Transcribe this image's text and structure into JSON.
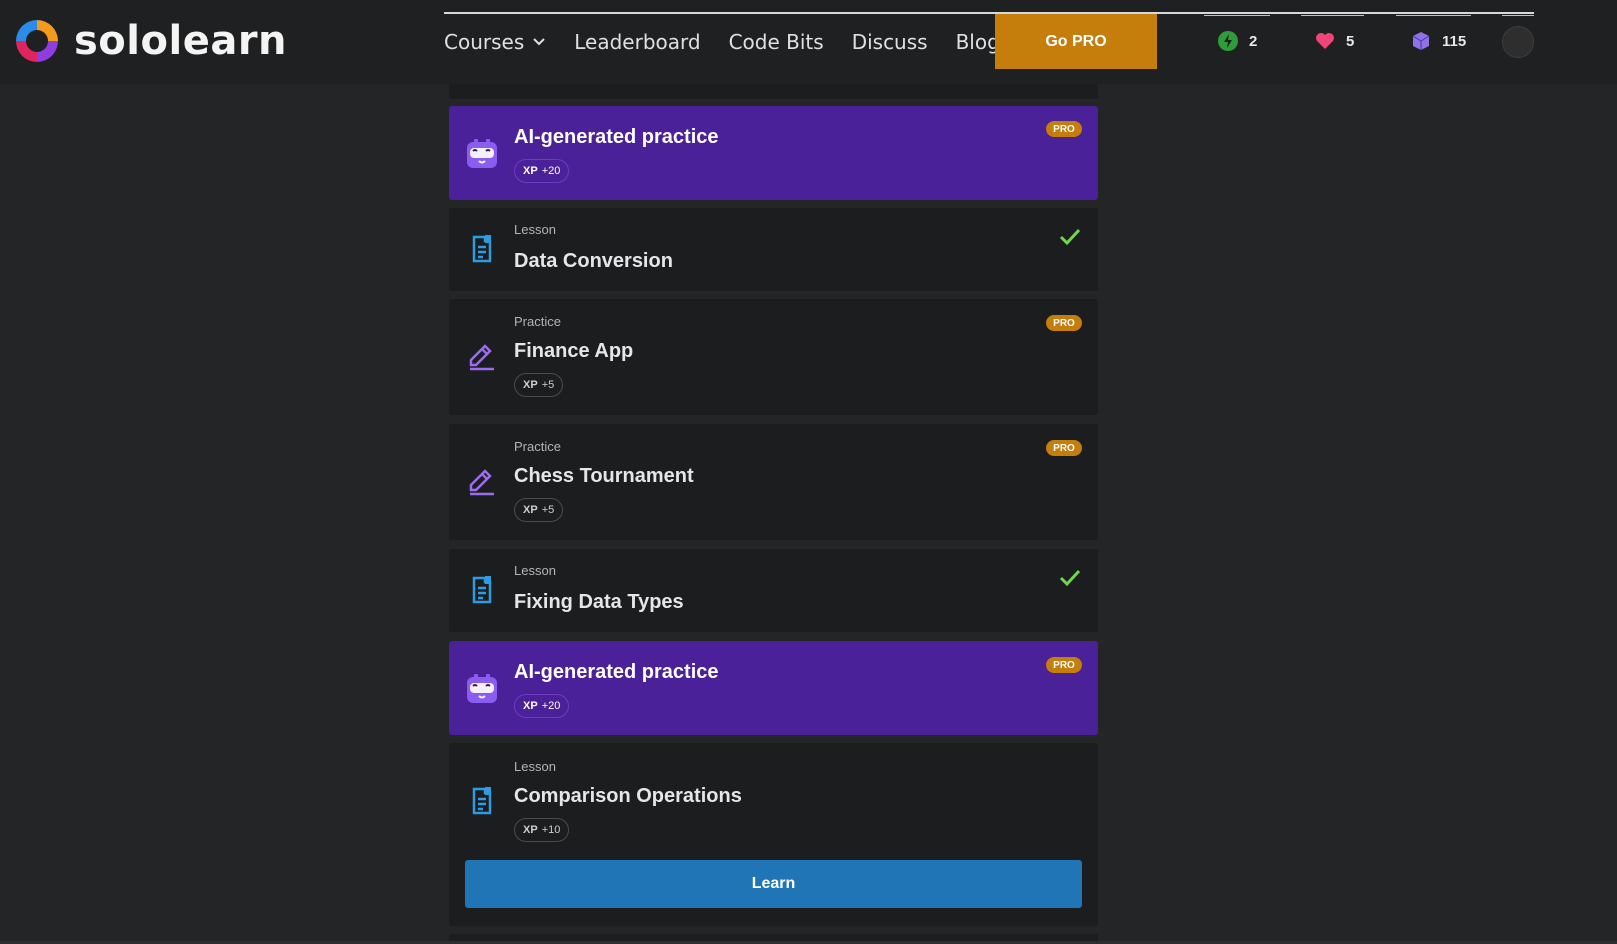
{
  "brand": {
    "name": "sololearn"
  },
  "nav": {
    "items": [
      {
        "label": "Courses"
      },
      {
        "label": "Leaderboard"
      },
      {
        "label": "Code Bits"
      },
      {
        "label": "Discuss"
      },
      {
        "label": "Blog"
      }
    ],
    "gopro_label": "Go PRO"
  },
  "stats": {
    "streak": "2",
    "hearts": "5",
    "bits": "115"
  },
  "colors": {
    "accent_purple": "#4a2199",
    "pro_orange": "#c57d0b",
    "learn_blue": "#1f75b5",
    "check_green": "#6cd84a"
  },
  "list": [
    {
      "type": "ai",
      "title": "AI-generated practice",
      "xp": "+20",
      "pro": "PRO"
    },
    {
      "type": "lesson",
      "kind": "Lesson",
      "title": "Data Conversion",
      "done": true
    },
    {
      "type": "practice",
      "kind": "Practice",
      "title": "Finance App",
      "xp": "+5",
      "pro": "PRO"
    },
    {
      "type": "practice",
      "kind": "Practice",
      "title": "Chess Tournament",
      "xp": "+5",
      "pro": "PRO"
    },
    {
      "type": "lesson",
      "kind": "Lesson",
      "title": "Fixing Data Types",
      "done": true
    },
    {
      "type": "ai",
      "title": "AI-generated practice",
      "xp": "+20",
      "pro": "PRO"
    },
    {
      "type": "lesson",
      "kind": "Lesson",
      "title": "Comparison Operations",
      "xp": "+10",
      "cta": "Learn"
    }
  ],
  "xp_label": "XP"
}
